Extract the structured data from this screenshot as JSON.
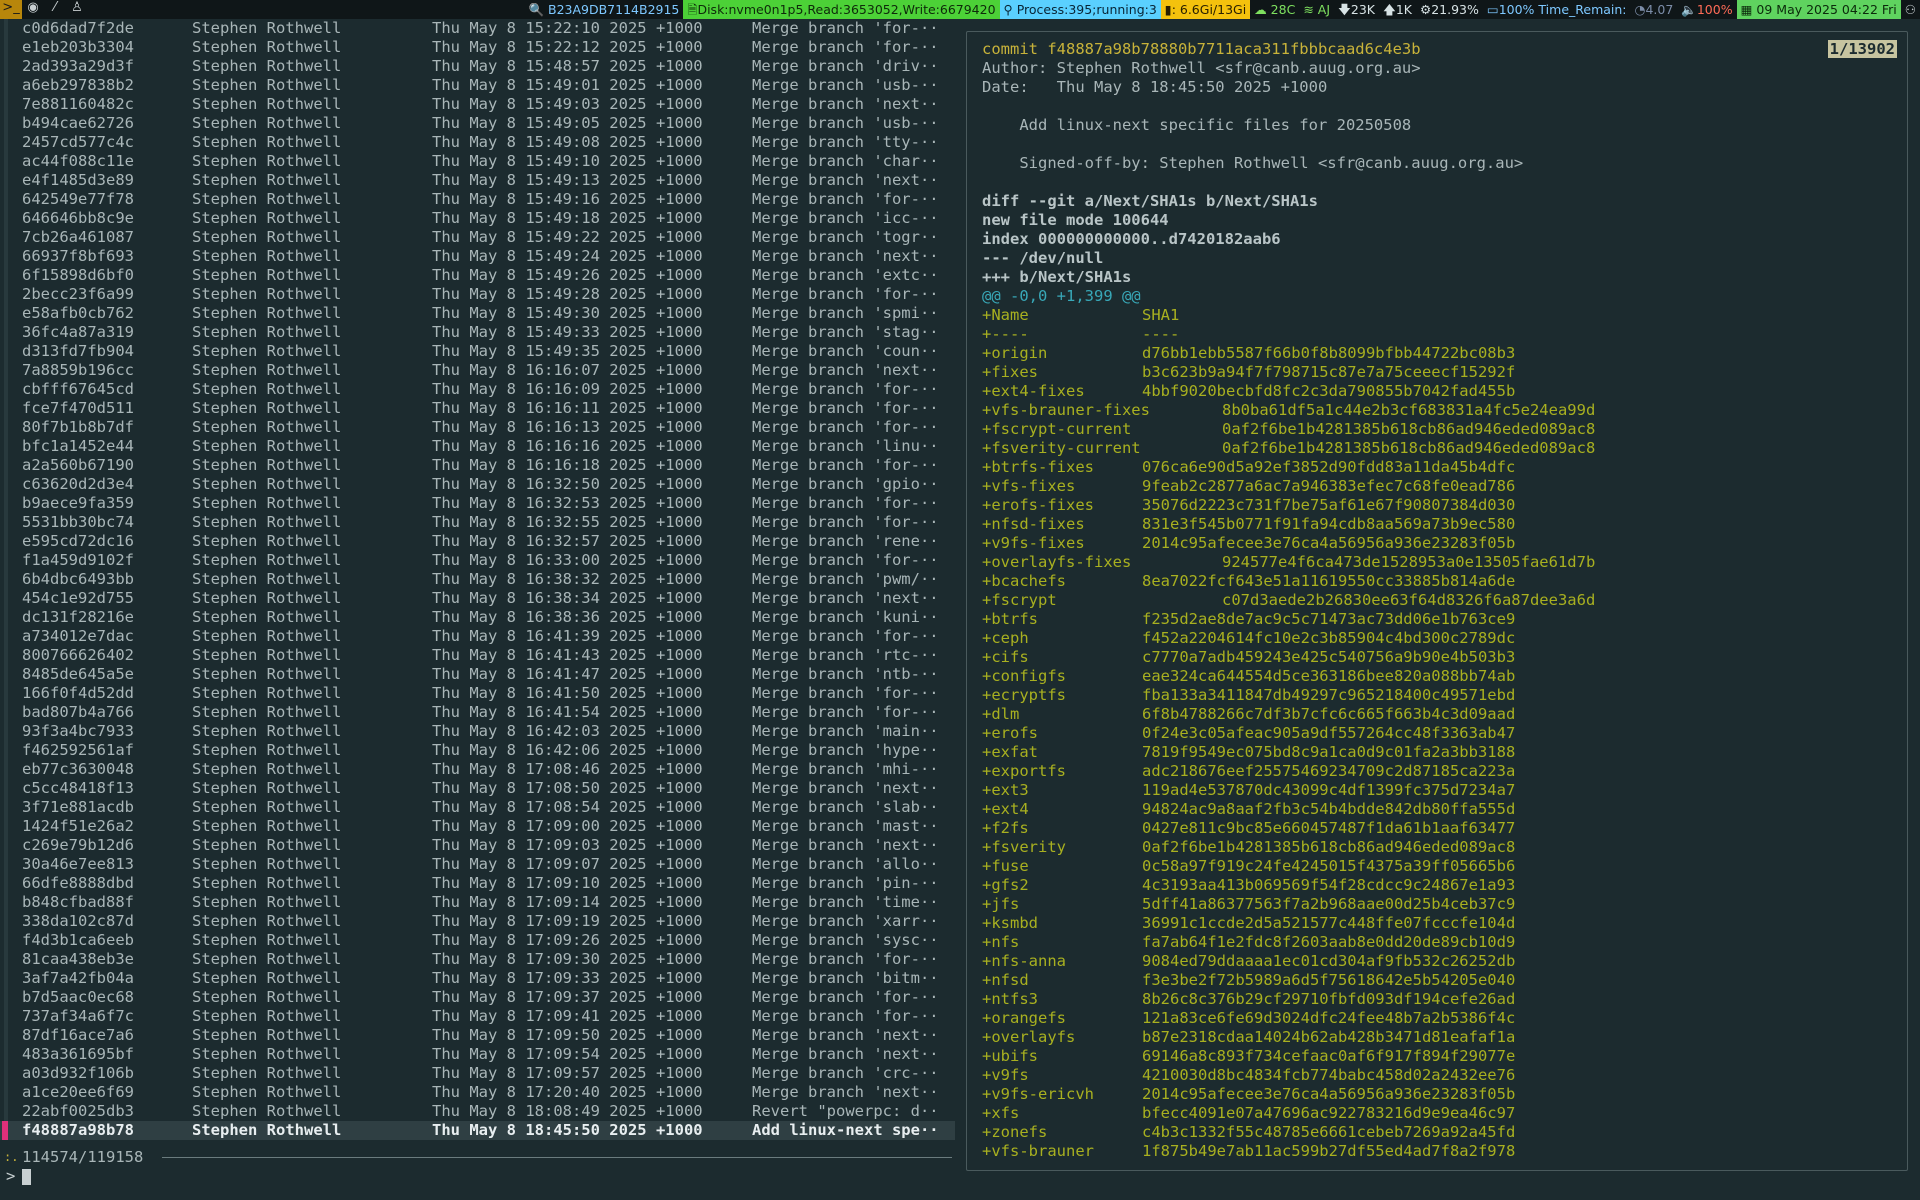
{
  "topbar": {
    "hash": "B23A9DB7114B2915",
    "disk": "Disk:nvme0n1p5,Read:3653052,Write:6679420",
    "process": "Process:395;running:3",
    "mem": ": 6.6Gi/13Gi",
    "temp": "28C",
    "ssid": "AJ",
    "down": "23K",
    "up": "1K",
    "cpu": "21.93%",
    "battery": "100% Time_Remain:",
    "load": "4.07",
    "volume": "100%",
    "date": "09 May 2025 04:22 Fri"
  },
  "log": {
    "rows": [
      {
        "hash": "c0d6dad7f2de",
        "author": "Stephen Rothwell",
        "date": "Thu May 8 15:22:10 2025 +1000",
        "subject": "Merge branch 'for-··"
      },
      {
        "hash": "e1eb203b3304",
        "author": "Stephen Rothwell",
        "date": "Thu May 8 15:22:12 2025 +1000",
        "subject": "Merge branch 'for-··"
      },
      {
        "hash": "2ad393a29d3f",
        "author": "Stephen Rothwell",
        "date": "Thu May 8 15:48:57 2025 +1000",
        "subject": "Merge branch 'driv··"
      },
      {
        "hash": "a6eb297838b2",
        "author": "Stephen Rothwell",
        "date": "Thu May 8 15:49:01 2025 +1000",
        "subject": "Merge branch 'usb-··"
      },
      {
        "hash": "7e881160482c",
        "author": "Stephen Rothwell",
        "date": "Thu May 8 15:49:03 2025 +1000",
        "subject": "Merge branch 'next··"
      },
      {
        "hash": "b494cae62726",
        "author": "Stephen Rothwell",
        "date": "Thu May 8 15:49:05 2025 +1000",
        "subject": "Merge branch 'usb-··"
      },
      {
        "hash": "2457cd577c4c",
        "author": "Stephen Rothwell",
        "date": "Thu May 8 15:49:08 2025 +1000",
        "subject": "Merge branch 'tty-··"
      },
      {
        "hash": "ac44f088c11e",
        "author": "Stephen Rothwell",
        "date": "Thu May 8 15:49:10 2025 +1000",
        "subject": "Merge branch 'char··"
      },
      {
        "hash": "e4f1485d3e89",
        "author": "Stephen Rothwell",
        "date": "Thu May 8 15:49:13 2025 +1000",
        "subject": "Merge branch 'next··"
      },
      {
        "hash": "642549e77f78",
        "author": "Stephen Rothwell",
        "date": "Thu May 8 15:49:16 2025 +1000",
        "subject": "Merge branch 'for-··"
      },
      {
        "hash": "646646bb8c9e",
        "author": "Stephen Rothwell",
        "date": "Thu May 8 15:49:18 2025 +1000",
        "subject": "Merge branch 'icc-··"
      },
      {
        "hash": "7cb26a461087",
        "author": "Stephen Rothwell",
        "date": "Thu May 8 15:49:22 2025 +1000",
        "subject": "Merge branch 'togr··"
      },
      {
        "hash": "66937f8bf693",
        "author": "Stephen Rothwell",
        "date": "Thu May 8 15:49:24 2025 +1000",
        "subject": "Merge branch 'next··"
      },
      {
        "hash": "6f15898d6bf0",
        "author": "Stephen Rothwell",
        "date": "Thu May 8 15:49:26 2025 +1000",
        "subject": "Merge branch 'extc··"
      },
      {
        "hash": "2becc23f6a99",
        "author": "Stephen Rothwell",
        "date": "Thu May 8 15:49:28 2025 +1000",
        "subject": "Merge branch 'for-··"
      },
      {
        "hash": "e58afb0cb762",
        "author": "Stephen Rothwell",
        "date": "Thu May 8 15:49:30 2025 +1000",
        "subject": "Merge branch 'spmi··"
      },
      {
        "hash": "36fc4a87a319",
        "author": "Stephen Rothwell",
        "date": "Thu May 8 15:49:33 2025 +1000",
        "subject": "Merge branch 'stag··"
      },
      {
        "hash": "d313fd7fb904",
        "author": "Stephen Rothwell",
        "date": "Thu May 8 15:49:35 2025 +1000",
        "subject": "Merge branch 'coun··"
      },
      {
        "hash": "7a8859b196cc",
        "author": "Stephen Rothwell",
        "date": "Thu May 8 16:16:07 2025 +1000",
        "subject": "Merge branch 'next··"
      },
      {
        "hash": "cbfff67645cd",
        "author": "Stephen Rothwell",
        "date": "Thu May 8 16:16:09 2025 +1000",
        "subject": "Merge branch 'for-··"
      },
      {
        "hash": "fce7f470d511",
        "author": "Stephen Rothwell",
        "date": "Thu May 8 16:16:11 2025 +1000",
        "subject": "Merge branch 'for-··"
      },
      {
        "hash": "80f7b1b8b7df",
        "author": "Stephen Rothwell",
        "date": "Thu May 8 16:16:13 2025 +1000",
        "subject": "Merge branch 'for-··"
      },
      {
        "hash": "bfc1a1452e44",
        "author": "Stephen Rothwell",
        "date": "Thu May 8 16:16:16 2025 +1000",
        "subject": "Merge branch 'linu··"
      },
      {
        "hash": "a2a560b67190",
        "author": "Stephen Rothwell",
        "date": "Thu May 8 16:16:18 2025 +1000",
        "subject": "Merge branch 'for-··"
      },
      {
        "hash": "c63620d2d3e4",
        "author": "Stephen Rothwell",
        "date": "Thu May 8 16:32:50 2025 +1000",
        "subject": "Merge branch 'gpio··"
      },
      {
        "hash": "b9aece9fa359",
        "author": "Stephen Rothwell",
        "date": "Thu May 8 16:32:53 2025 +1000",
        "subject": "Merge branch 'for-··"
      },
      {
        "hash": "5531bb30bc74",
        "author": "Stephen Rothwell",
        "date": "Thu May 8 16:32:55 2025 +1000",
        "subject": "Merge branch 'for-··"
      },
      {
        "hash": "e595cd72dc16",
        "author": "Stephen Rothwell",
        "date": "Thu May 8 16:32:57 2025 +1000",
        "subject": "Merge branch 'rene··"
      },
      {
        "hash": "f1a459d9102f",
        "author": "Stephen Rothwell",
        "date": "Thu May 8 16:33:00 2025 +1000",
        "subject": "Merge branch 'for-··"
      },
      {
        "hash": "6b4dbc6493bb",
        "author": "Stephen Rothwell",
        "date": "Thu May 8 16:38:32 2025 +1000",
        "subject": "Merge branch 'pwm/··"
      },
      {
        "hash": "454c1e92d755",
        "author": "Stephen Rothwell",
        "date": "Thu May 8 16:38:34 2025 +1000",
        "subject": "Merge branch 'next··"
      },
      {
        "hash": "dc131f28216e",
        "author": "Stephen Rothwell",
        "date": "Thu May 8 16:38:36 2025 +1000",
        "subject": "Merge branch 'kuni··"
      },
      {
        "hash": "a734012e7dac",
        "author": "Stephen Rothwell",
        "date": "Thu May 8 16:41:39 2025 +1000",
        "subject": "Merge branch 'for-··"
      },
      {
        "hash": "800766626402",
        "author": "Stephen Rothwell",
        "date": "Thu May 8 16:41:43 2025 +1000",
        "subject": "Merge branch 'rtc-··"
      },
      {
        "hash": "8485de645a5e",
        "author": "Stephen Rothwell",
        "date": "Thu May 8 16:41:47 2025 +1000",
        "subject": "Merge branch 'ntb-··"
      },
      {
        "hash": "166f0f4d52dd",
        "author": "Stephen Rothwell",
        "date": "Thu May 8 16:41:50 2025 +1000",
        "subject": "Merge branch 'for-··"
      },
      {
        "hash": "bad807b4a766",
        "author": "Stephen Rothwell",
        "date": "Thu May 8 16:41:54 2025 +1000",
        "subject": "Merge branch 'for-··"
      },
      {
        "hash": "93f3a4bc7933",
        "author": "Stephen Rothwell",
        "date": "Thu May 8 16:42:03 2025 +1000",
        "subject": "Merge branch 'main··"
      },
      {
        "hash": "f462592561af",
        "author": "Stephen Rothwell",
        "date": "Thu May 8 16:42:06 2025 +1000",
        "subject": "Merge branch 'hype··"
      },
      {
        "hash": "eb77c3630048",
        "author": "Stephen Rothwell",
        "date": "Thu May 8 17:08:46 2025 +1000",
        "subject": "Merge branch 'mhi-··"
      },
      {
        "hash": "c5cc48418f13",
        "author": "Stephen Rothwell",
        "date": "Thu May 8 17:08:50 2025 +1000",
        "subject": "Merge branch 'next··"
      },
      {
        "hash": "3f71e881acdb",
        "author": "Stephen Rothwell",
        "date": "Thu May 8 17:08:54 2025 +1000",
        "subject": "Merge branch 'slab··"
      },
      {
        "hash": "1424f51e26a2",
        "author": "Stephen Rothwell",
        "date": "Thu May 8 17:09:00 2025 +1000",
        "subject": "Merge branch 'mast··"
      },
      {
        "hash": "c269e79b12d6",
        "author": "Stephen Rothwell",
        "date": "Thu May 8 17:09:03 2025 +1000",
        "subject": "Merge branch 'next··"
      },
      {
        "hash": "30a46e7ee813",
        "author": "Stephen Rothwell",
        "date": "Thu May 8 17:09:07 2025 +1000",
        "subject": "Merge branch 'allo··"
      },
      {
        "hash": "66dfe8888dbd",
        "author": "Stephen Rothwell",
        "date": "Thu May 8 17:09:10 2025 +1000",
        "subject": "Merge branch 'pin-··"
      },
      {
        "hash": "b848cfbad88f",
        "author": "Stephen Rothwell",
        "date": "Thu May 8 17:09:14 2025 +1000",
        "subject": "Merge branch 'time··"
      },
      {
        "hash": "338da102c87d",
        "author": "Stephen Rothwell",
        "date": "Thu May 8 17:09:19 2025 +1000",
        "subject": "Merge branch 'xarr··"
      },
      {
        "hash": "f4d3b1ca6eeb",
        "author": "Stephen Rothwell",
        "date": "Thu May 8 17:09:26 2025 +1000",
        "subject": "Merge branch 'sysc··"
      },
      {
        "hash": "81caa438eb3e",
        "author": "Stephen Rothwell",
        "date": "Thu May 8 17:09:30 2025 +1000",
        "subject": "Merge branch 'for-··"
      },
      {
        "hash": "3af7a42fb04a",
        "author": "Stephen Rothwell",
        "date": "Thu May 8 17:09:33 2025 +1000",
        "subject": "Merge branch 'bitm··"
      },
      {
        "hash": "b7d5aac0ec68",
        "author": "Stephen Rothwell",
        "date": "Thu May 8 17:09:37 2025 +1000",
        "subject": "Merge branch 'for-··"
      },
      {
        "hash": "737af34a6f7c",
        "author": "Stephen Rothwell",
        "date": "Thu May 8 17:09:41 2025 +1000",
        "subject": "Merge branch 'for-··"
      },
      {
        "hash": "87df16ace7a6",
        "author": "Stephen Rothwell",
        "date": "Thu May 8 17:09:50 2025 +1000",
        "subject": "Merge branch 'next··"
      },
      {
        "hash": "483a361695bf",
        "author": "Stephen Rothwell",
        "date": "Thu May 8 17:09:54 2025 +1000",
        "subject": "Merge branch 'next··"
      },
      {
        "hash": "a03d932f106b",
        "author": "Stephen Rothwell",
        "date": "Thu May 8 17:09:57 2025 +1000",
        "subject": "Merge branch 'crc-··"
      },
      {
        "hash": "a1ce20ee6f69",
        "author": "Stephen Rothwell",
        "date": "Thu May 8 17:20:40 2025 +1000",
        "subject": "Merge branch 'next··"
      },
      {
        "hash": "22abf0025db3",
        "author": "Stephen Rothwell",
        "date": "Thu May 8 18:08:49 2025 +1000",
        "subject": "Revert \"powerpc: d··"
      },
      {
        "hash": "f48887a98b78",
        "author": "Stephen Rothwell",
        "date": "Thu May 8 18:45:50 2025 +1000",
        "subject": "Add linux-next spe··"
      }
    ],
    "counter": "114574/119158",
    "prompt": ">"
  },
  "preview": {
    "position": "1/13902",
    "commit": "commit f48887a98b78880b7711aca311fbbbcaad6c4e3b",
    "author": "Author: Stephen Rothwell <sfr@canb.auug.org.au>",
    "date": "Date:   Thu May 8 18:45:50 2025 +1000",
    "message": "    Add linux-next specific files for 20250508",
    "signoff": "    Signed-off-by: Stephen Rothwell <sfr@canb.auug.org.au>",
    "diff_header": [
      "diff --git a/Next/SHA1s b/Next/SHA1s",
      "new file mode 100644",
      "index 000000000000..d7420182aab6",
      "--- /dev/null",
      "+++ b/Next/SHA1s"
    ],
    "hunk": "@@ -0,0 +1,399 @@",
    "table_header": [
      {
        "k": "+Name",
        "v": "SHA1"
      },
      {
        "k": "+----",
        "v": "----"
      }
    ],
    "entries": [
      {
        "k": "+origin",
        "v": "d76bb1ebb5587f66b0f8b8099bfbb44722bc08b3"
      },
      {
        "k": "+fixes",
        "v": "b3c623b9a94f7f798715c87e7a75ceeecf15292f"
      },
      {
        "k": "+ext4-fixes",
        "v": "4bbf9020becbfd8fc2c3da790855b7042fad455b"
      },
      {
        "k": "+vfs-brauner-fixes",
        "v": "8b0ba61df5a1c44e2b3cf683831a4fc5e24ea99d",
        "w": true
      },
      {
        "k": "+fscrypt-current",
        "v": "0af2f6be1b4281385b618cb86ad946eded089ac8",
        "w": true
      },
      {
        "k": "+fsverity-current",
        "v": "0af2f6be1b4281385b618cb86ad946eded089ac8",
        "w": true
      },
      {
        "k": "+btrfs-fixes",
        "v": "076ca6e90d5a92ef3852d90fdd83a11da45b4dfc"
      },
      {
        "k": "+vfs-fixes",
        "v": "9feab2c2877a6ac7a946383efec7c68fe0ead786"
      },
      {
        "k": "+erofs-fixes",
        "v": "35076d2223c731f7be75af61e67f90807384d030"
      },
      {
        "k": "+nfsd-fixes",
        "v": "831e3f545b0771f91fa94cdb8aa569a73b9ec580"
      },
      {
        "k": "+v9fs-fixes",
        "v": "2014c95afecee3e76ca4a56956a936e23283f05b"
      },
      {
        "k": "+overlayfs-fixes",
        "v": "924577e4f6ca473de1528953a0e13505fae61d7b",
        "w": true
      },
      {
        "k": "+bcachefs",
        "v": "8ea7022fcf643e51a11619550cc33885b814a6de"
      },
      {
        "k": "+fscrypt",
        "v": "c07d3aede2b26830ee63f64d8326f6a87dee3a6d",
        "w": true
      },
      {
        "k": "+btrfs",
        "v": "f235d2ae8de7ac9c5c71473ac73dd06e1b763ce9"
      },
      {
        "k": "+ceph",
        "v": "f452a2204614fc10e2c3b85904c4bd300c2789dc"
      },
      {
        "k": "+cifs",
        "v": "c7770a7adb459243e425c540756a9b90e4b503b3"
      },
      {
        "k": "+configfs",
        "v": "eae324ca644554d5ce363186bee820a088bb74ab"
      },
      {
        "k": "+ecryptfs",
        "v": "fba133a3411847db49297c965218400c49571ebd"
      },
      {
        "k": "+dlm",
        "v": "6f8b4788266c7df3b7cfc6c665f663b4c3d09aad"
      },
      {
        "k": "+erofs",
        "v": "0f24e3c05afeac905a9df557264cc48f3363ab47"
      },
      {
        "k": "+exfat",
        "v": "7819f9549ec075bd8c9a1ca0d9c01fa2a3bb3188"
      },
      {
        "k": "+exportfs",
        "v": "adc218676eef25575469234709c2d87185ca223a"
      },
      {
        "k": "+ext3",
        "v": "119ad4e537870dc43099c4df1399fc375d7234a7"
      },
      {
        "k": "+ext4",
        "v": "94824ac9a8aaf2fb3c54b4bdde842db80ffa555d"
      },
      {
        "k": "+f2fs",
        "v": "0427e811c9bc85e660457487f1da61b1aaf63477"
      },
      {
        "k": "+fsverity",
        "v": "0af2f6be1b4281385b618cb86ad946eded089ac8"
      },
      {
        "k": "+fuse",
        "v": "0c58a97f919c24fe4245015f4375a39ff05665b6"
      },
      {
        "k": "+gfs2",
        "v": "4c3193aa413b069569f54f28cdcc9c24867e1a93"
      },
      {
        "k": "+jfs",
        "v": "5dff41a86377563f7a2b968aae00d25b4ceb37c9"
      },
      {
        "k": "+ksmbd",
        "v": "36991c1ccde2d5a521577c448ffe07fcccfe104d"
      },
      {
        "k": "+nfs",
        "v": "fa7ab64f1e2fdc8f2603aab8e0dd20de89cb10d9"
      },
      {
        "k": "+nfs-anna",
        "v": "9084ed79ddaaaa1ec01cd304af9fb532c26252db"
      },
      {
        "k": "+nfsd",
        "v": "f3e3be2f72b5989a6d5f75618642e5b54205e040"
      },
      {
        "k": "+ntfs3",
        "v": "8b26c8c376b29cf29710fbfd093df194cefe26ad"
      },
      {
        "k": "+orangefs",
        "v": "121a83ce6fe69d3024dfc24fee48b7a2b5386f4c"
      },
      {
        "k": "+overlayfs",
        "v": "b87e2318cdaa14024b62ab428b3471d81eafaf1a"
      },
      {
        "k": "+ubifs",
        "v": "69146a8c893f734cefaac0af6f917f894f29077e"
      },
      {
        "k": "+v9fs",
        "v": "4210030d8bc4834fcb774babc458d02a2432ee76"
      },
      {
        "k": "+v9fs-ericvh",
        "v": "2014c95afecee3e76ca4a56956a936e23283f05b"
      },
      {
        "k": "+xfs",
        "v": "bfecc4091e07a47696ac922783216d9e9ea46c97"
      },
      {
        "k": "+zonefs",
        "v": "c4b3c1332f55c48785e6661cebeb7269a92a45fd"
      },
      {
        "k": "+vfs-brauner",
        "v": "1f875b49e7ab11ac599b27df55ed4ad7f8a2f978"
      }
    ]
  }
}
